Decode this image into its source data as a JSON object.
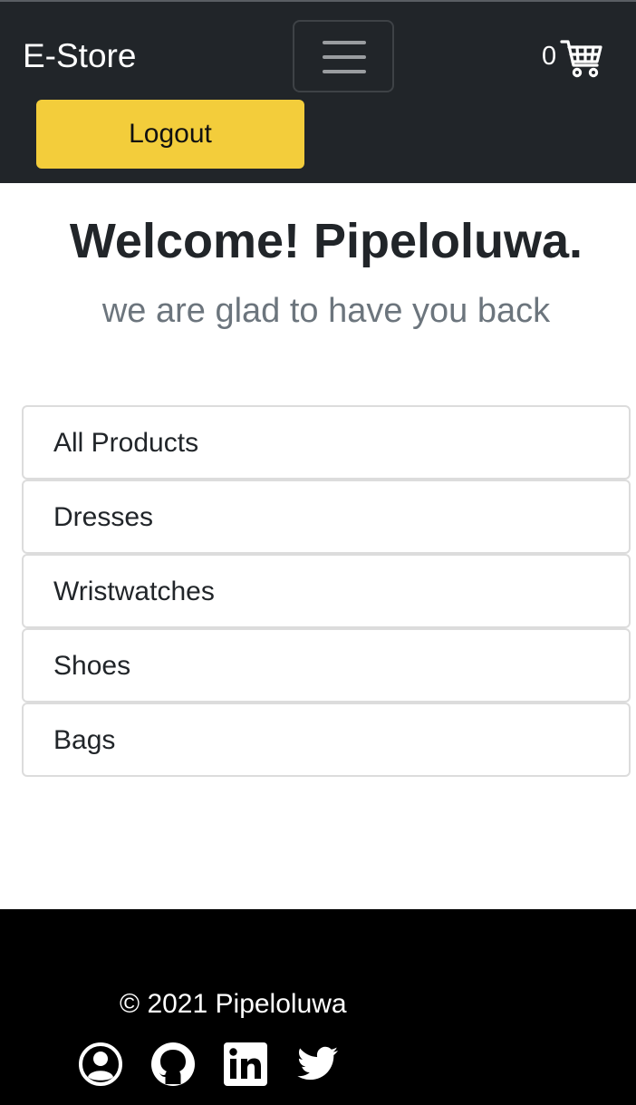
{
  "navbar": {
    "brand": "E-Store",
    "cart_count": "0",
    "logout_label": "Logout",
    "icons": {
      "menu": "hamburger-menu-icon",
      "cart": "shopping-cart-icon"
    }
  },
  "main": {
    "welcome": "Welcome! Pipeloluwa.",
    "subtitle": "we are glad to have you back",
    "categories": [
      "All Products",
      "Dresses",
      "Wristwatches",
      "Shoes",
      "Bags"
    ]
  },
  "footer": {
    "copyright": "© 2021 Pipeloluwa",
    "social_icons": [
      "profile-icon",
      "github-icon",
      "linkedin-icon",
      "twitter-icon"
    ]
  },
  "colors": {
    "navbar_bg": "#212529",
    "logout_bg": "#f3cd3b",
    "footer_bg": "#000000",
    "subtitle": "#6c757d"
  }
}
